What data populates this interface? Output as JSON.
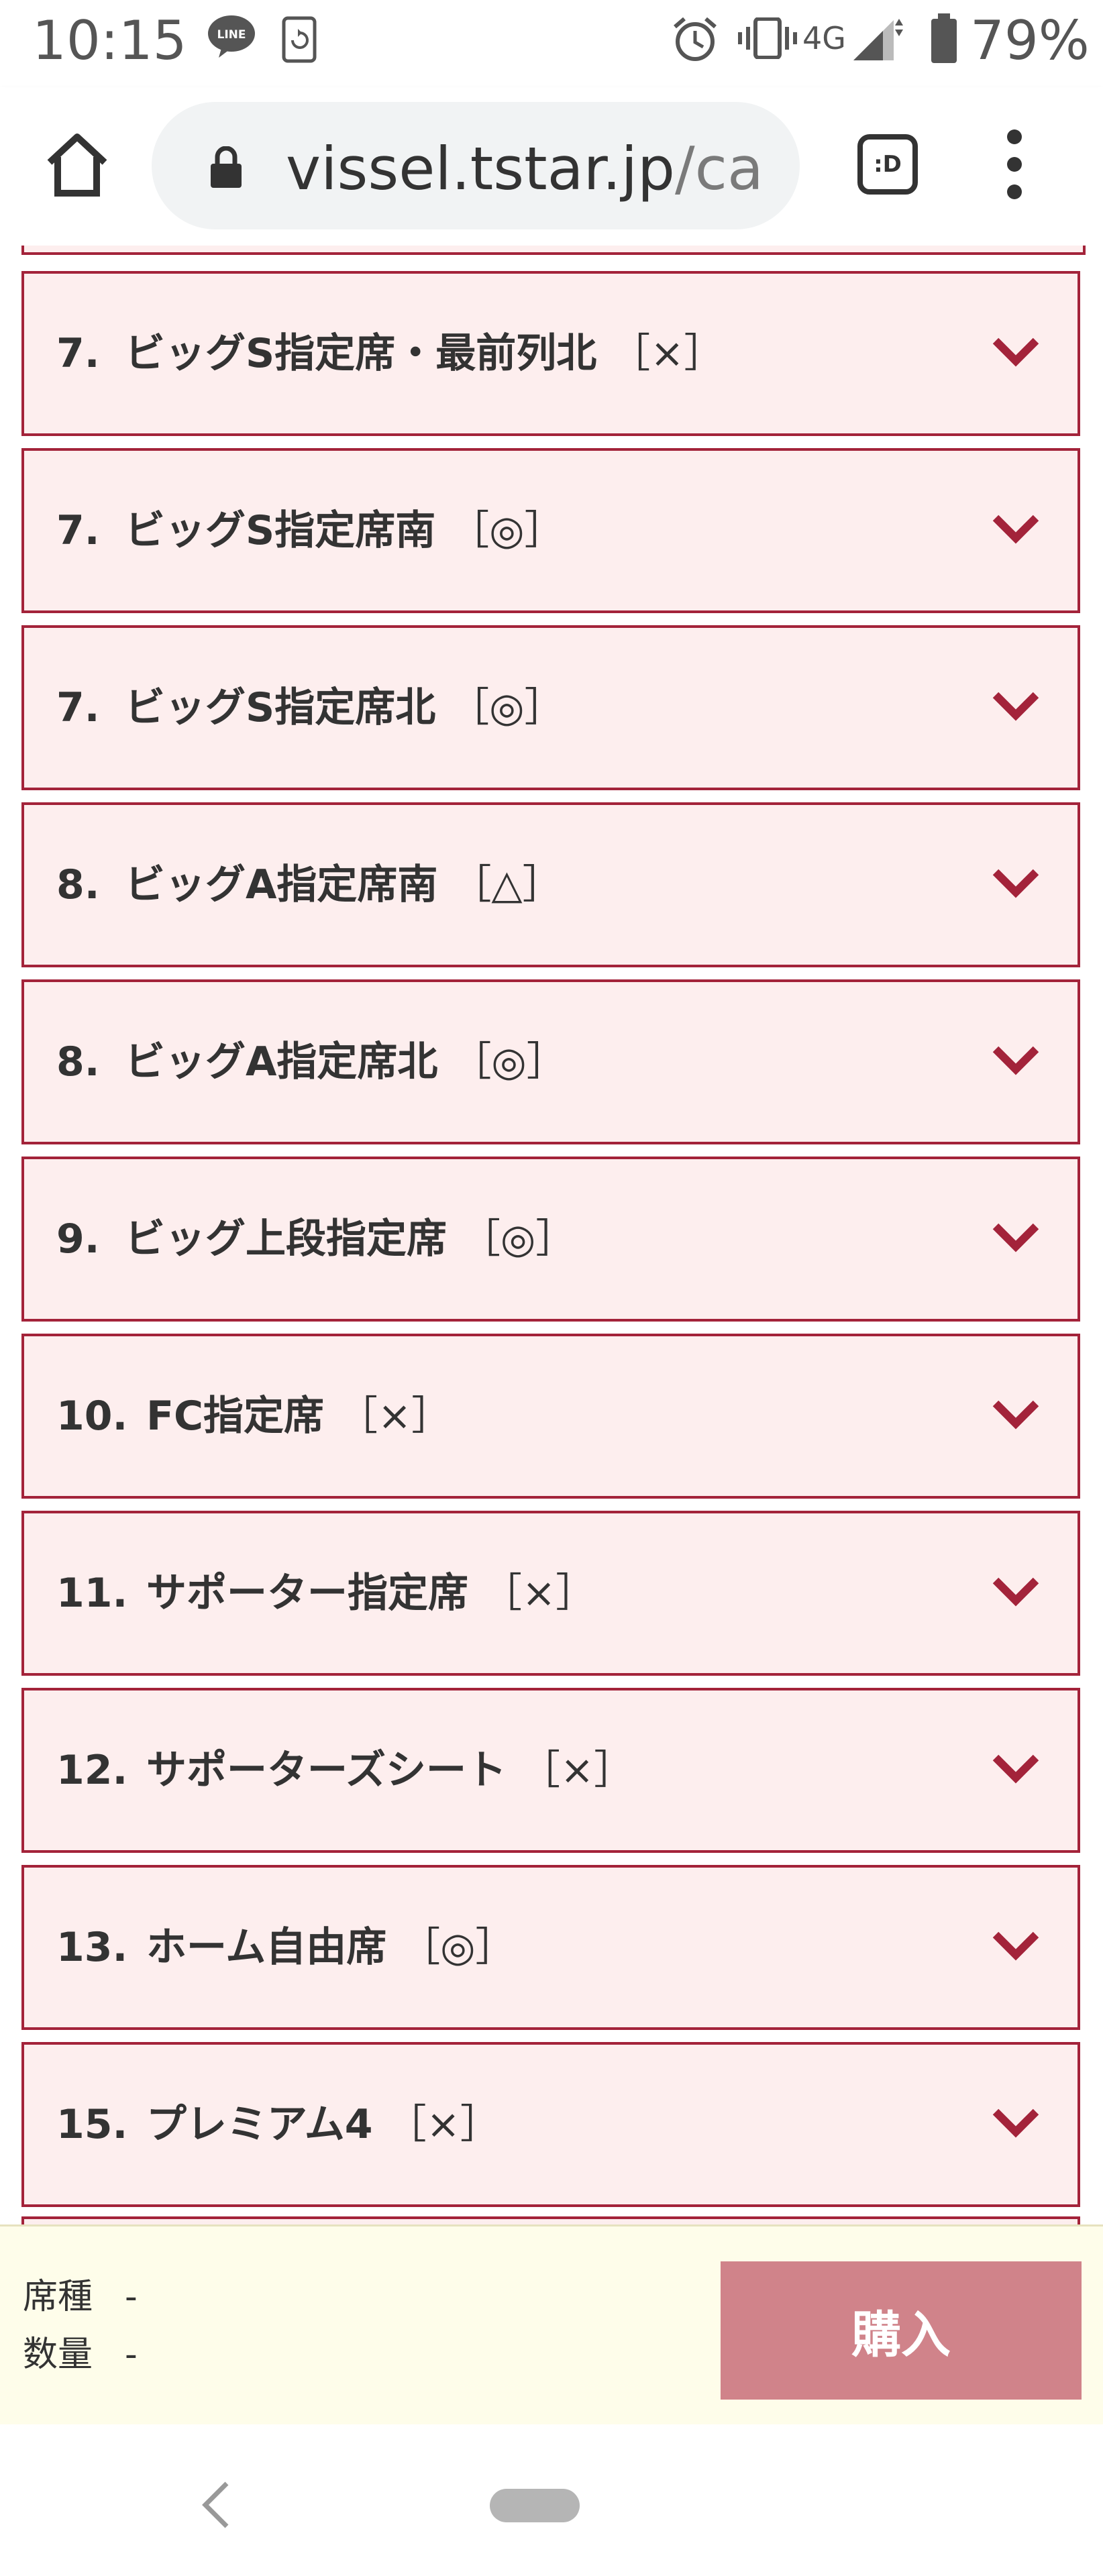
{
  "status_bar": {
    "time": "10:15",
    "network": "4G",
    "battery": "79%",
    "icons": [
      "line-app-icon",
      "sync-icon",
      "alarm-icon",
      "vibrate-icon",
      "signal-icon",
      "battery-icon"
    ]
  },
  "browser": {
    "url_main": "vissel.tstar.jp",
    "url_rest": "/ca",
    "tab_icon_text": ":D"
  },
  "items": [
    {
      "num": "7.",
      "label": "ビッグS指定席・最前列北",
      "mark": "［×］"
    },
    {
      "num": "7.",
      "label": "ビッグS指定席南",
      "mark": "［◎］"
    },
    {
      "num": "7.",
      "label": "ビッグS指定席北",
      "mark": "［◎］"
    },
    {
      "num": "8.",
      "label": "ビッグA指定席南",
      "mark": "［△］"
    },
    {
      "num": "8.",
      "label": "ビッグA指定席北",
      "mark": "［◎］"
    },
    {
      "num": "9.",
      "label": "ビッグ上段指定席",
      "mark": "［◎］"
    },
    {
      "num": "10.",
      "label": "FC指定席",
      "mark": "［×］"
    },
    {
      "num": "11.",
      "label": "サポーター指定席",
      "mark": "［×］"
    },
    {
      "num": "12.",
      "label": "サポーターズシート",
      "mark": "［×］"
    },
    {
      "num": "13.",
      "label": "ホーム自由席",
      "mark": "［◎］"
    },
    {
      "num": "15.",
      "label": "プレミアム4",
      "mark": "［×］"
    }
  ],
  "purchase": {
    "seat_type_label": "席種",
    "seat_type_value": "-",
    "quantity_label": "数量",
    "quantity_value": "-",
    "buy_label": "購入"
  },
  "colors": {
    "accent": "#a3233a",
    "item_bg": "#fdeeee",
    "panel_bg": "#fefdea",
    "buy_bg": "#d0838a"
  }
}
